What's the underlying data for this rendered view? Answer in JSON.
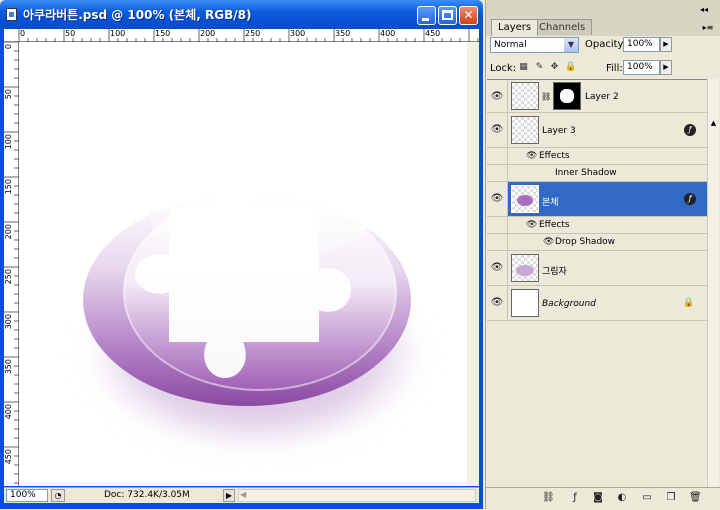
{
  "window": {
    "title": "아쿠라버튼.psd @ 100% (본체, RGB/8)",
    "minimize": "",
    "maximize": "",
    "close": "✕"
  },
  "ruler": {
    "top_labels": [
      "0",
      "50",
      "100",
      "150",
      "200",
      "250",
      "300",
      "350",
      "400",
      "450"
    ],
    "left_labels": [
      "0",
      "50",
      "100",
      "150",
      "200",
      "250",
      "300",
      "350",
      "400",
      "450"
    ]
  },
  "status": {
    "zoom": "100%",
    "doc_size": "Doc: 732.4K/3.05M"
  },
  "panel": {
    "tabs": [
      "Layers",
      "Channels"
    ],
    "blend_mode": "Normal",
    "opacity_label": "Opacity:",
    "opacity_value": "100%",
    "lock_label": "Lock:",
    "fill_label": "Fill:",
    "fill_value": "100%"
  },
  "layers": [
    {
      "name": "Layer 2",
      "visible": true,
      "has_mask": true
    },
    {
      "name": "Layer 3",
      "visible": true,
      "fx": true,
      "effects_label": "Effects",
      "effects": [
        "Inner Shadow"
      ]
    },
    {
      "name": "본체",
      "visible": true,
      "selected": true,
      "fx": true,
      "effects_label": "Effects",
      "effects": [
        "Drop Shadow"
      ]
    },
    {
      "name": "그림자",
      "visible": true
    },
    {
      "name": "Background",
      "visible": true,
      "locked": true
    }
  ],
  "colors": {
    "selection": "#316ac5",
    "titlebar": "#0651d4",
    "button_purple": "#9a5aab"
  },
  "icons": {
    "eye": "eye-icon",
    "fx": "fx-icon",
    "lock": "lock-icon",
    "link": "link-icon"
  }
}
